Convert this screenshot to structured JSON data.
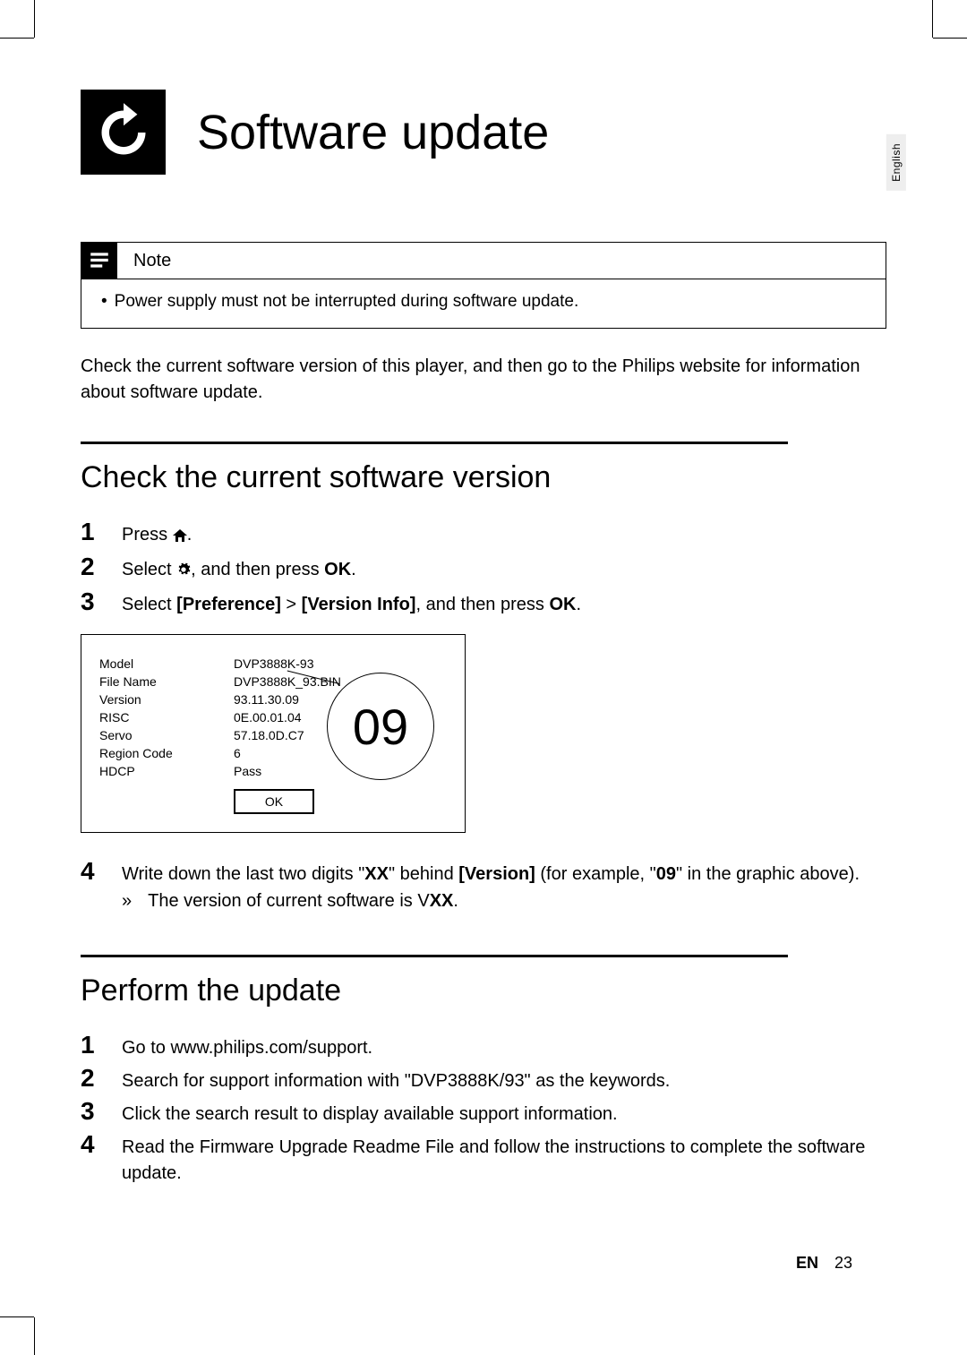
{
  "lang_tab": "English",
  "title": "Software update",
  "note": {
    "label": "Note",
    "body": "Power supply must not be interrupted during software update."
  },
  "intro": "Check the current software version of this player, and then go to the Philips website for information about software update.",
  "section1": {
    "title": "Check the current software version",
    "steps": {
      "s1_a": "Press ",
      "s1_b": ".",
      "s2_a": "Select ",
      "s2_b": ", and then press ",
      "s2_ok": "OK",
      "s2_c": ".",
      "s3_a": "Select ",
      "s3_pref": "[Preference]",
      "s3_gt": " > ",
      "s3_vi": "[Version Info]",
      "s3_b": ", and then press ",
      "s3_ok": "OK",
      "s3_c": "."
    },
    "screen": {
      "labels": {
        "model": "Model",
        "file": "File Name",
        "version": "Version",
        "risc": "RISC",
        "servo": "Servo",
        "region": "Region Code",
        "hdcp": "HDCP"
      },
      "values": {
        "model": "DVP3888K-93",
        "file": "DVP3888K_93.BIN",
        "version": "93.11.30.09",
        "risc": "0E.00.01.04",
        "servo": "57.18.0D.C7",
        "region": "6",
        "hdcp": "Pass"
      },
      "ok": "OK",
      "callout": "09"
    },
    "step4": {
      "a": "Write down the last two digits \"",
      "xx1": "XX",
      "b": "\" behind ",
      "ver": "[Version]",
      "c": " (for example, \"",
      "eg": "09",
      "d": "\" in the graphic above).",
      "sub_a": "The version of current software is V",
      "sub_xx": "XX",
      "sub_b": "."
    }
  },
  "section2": {
    "title": "Perform the update",
    "steps": {
      "s1": "Go to www.philips.com/support.",
      "s2": "Search for support information with \"DVP3888K/93\" as the keywords.",
      "s3": "Click the search result to display available support information.",
      "s4": "Read the Firmware Upgrade Readme File and follow the instructions to complete the software update."
    }
  },
  "footer": {
    "lang": "EN",
    "page": "23"
  }
}
